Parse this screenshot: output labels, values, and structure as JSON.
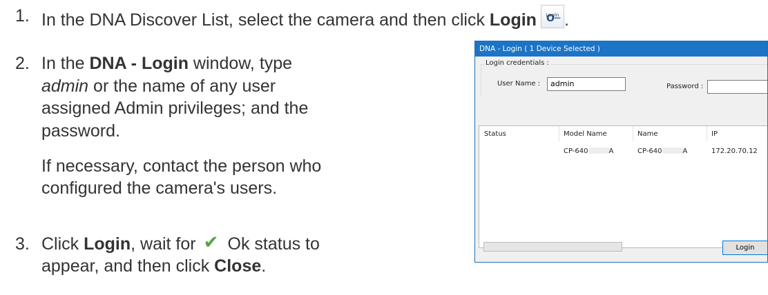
{
  "steps": [
    {
      "number": "1.",
      "text_before": "In the DNA Discover List, select the camera and then click ",
      "bold": "Login",
      "icon_name": "login-key-icon",
      "icon_caption": "Login"
    },
    {
      "number": "2.",
      "line1_a": "In the ",
      "line1_bold": "DNA - Login",
      "line1_b": " window, type",
      "line2_italic": "admin",
      "line2_rest": " or the name of any user",
      "line3": "assigned Admin privileges; and the",
      "line4": "password.",
      "note_line1": "If necessary, contact the person who",
      "note_line2": "configured the camera's users."
    },
    {
      "number": "3.",
      "line1_a": "Click ",
      "line1_bold": "Login",
      "line1_b": ", wait for ",
      "check_icon": "green-checkmark-icon",
      "line1_c": " Ok status to",
      "line2_a": "appear, and then click ",
      "line2_bold": "Close",
      "line2_b": "."
    }
  ],
  "dialog": {
    "title": "DNA - Login ( 1 Device Selected )",
    "group_label": "Login credentials :",
    "username_label": "User Name :",
    "username_value": "admin",
    "password_label": "Password :",
    "password_value": "",
    "columns": [
      "Status",
      "Model Name",
      "Name",
      "IP"
    ],
    "row": {
      "status": "",
      "model_prefix": "CP-640",
      "model_suffix": "A",
      "name_prefix": "CP-640",
      "name_suffix": "A",
      "ip": "172.20.70.12"
    },
    "login_button": "Login"
  },
  "colors": {
    "title_bar": "#1c74c6",
    "check": "#4ea838",
    "text": "#333333"
  }
}
